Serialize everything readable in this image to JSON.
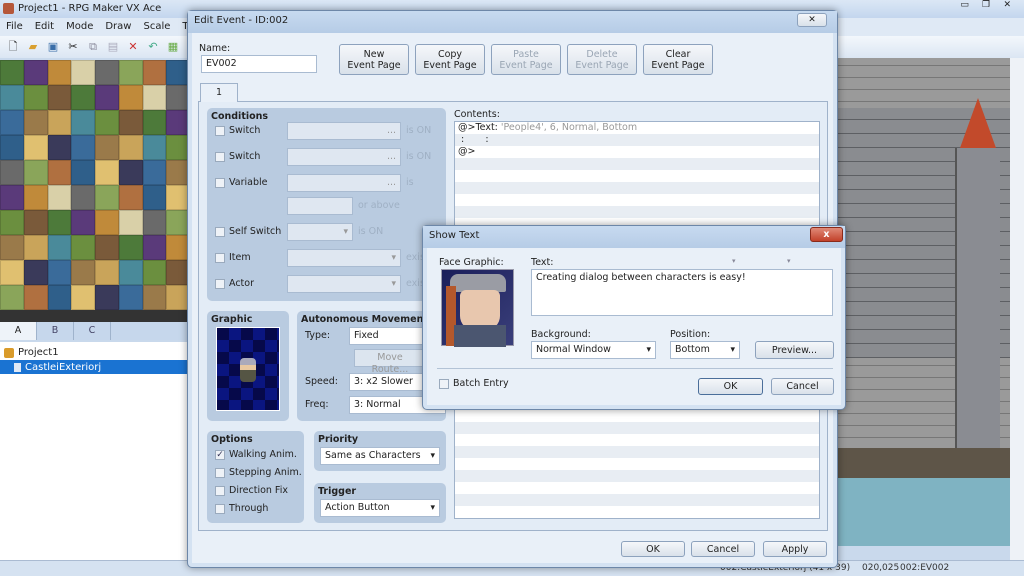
{
  "app": {
    "title": "Project1 - RPG Maker VX Ace",
    "menu": [
      "File",
      "Edit",
      "Mode",
      "Draw",
      "Scale",
      "Tools"
    ],
    "toolbar_icons": [
      "new-icon",
      "open-icon",
      "save-icon",
      "cut-icon",
      "copy-icon",
      "paste-icon",
      "delete-icon",
      "undo-icon",
      "tileset-icon"
    ],
    "tabs": [
      "A",
      "B",
      "C"
    ],
    "tree": {
      "project": "Project1",
      "map": "CastleiExteriorj"
    },
    "status": {
      "map": "002:CastleExteriorj (41 x 39)",
      "coords": "020,025",
      "event": "002:EV002"
    }
  },
  "edit_event": {
    "title": "Edit Event - ID:002",
    "name_label": "Name:",
    "name_value": "EV002",
    "buttons": {
      "new_page": "New\nEvent Page",
      "copy_page": "Copy\nEvent Page",
      "paste_page": "Paste\nEvent Page",
      "delete_page": "Delete\nEvent Page",
      "clear_page": "Clear\nEvent Page",
      "ok": "OK",
      "cancel": "Cancel",
      "apply": "Apply"
    },
    "page_tab": "1",
    "conditions": {
      "title": "Conditions",
      "switch1": "Switch",
      "switch2": "Switch",
      "variable": "Variable",
      "self_switch": "Self Switch",
      "item": "Item",
      "actor": "Actor",
      "is_on": "is ON",
      "is": "is",
      "or_above": "or above",
      "exists": "exists",
      "ellipsis": "..."
    },
    "graphic_title": "Graphic",
    "movement": {
      "title": "Autonomous Movement",
      "type_label": "Type:",
      "type": "Fixed",
      "move_route": "Move Route...",
      "speed_label": "Speed:",
      "speed": "3: x2 Slower",
      "freq_label": "Freq:",
      "freq": "3: Normal"
    },
    "options": {
      "title": "Options",
      "walking": "Walking Anim.",
      "stepping": "Stepping Anim.",
      "direction_fix": "Direction Fix",
      "through": "Through",
      "walking_checked": true
    },
    "priority": {
      "title": "Priority",
      "value": "Same as Characters"
    },
    "trigger": {
      "title": "Trigger",
      "value": "Action Button"
    },
    "contents": {
      "label": "Contents:",
      "line1_cmd": "@>Text:",
      "line1_args": "'People4', 6, Normal, Bottom",
      "line2": " :       :",
      "line3": "@>"
    }
  },
  "show_text": {
    "title": "Show Text",
    "close": "x",
    "face_label": "Face Graphic:",
    "text_label": "Text:",
    "text_value": "Creating dialog between characters is easy!",
    "background_label": "Background:",
    "background": "Normal Window",
    "position_label": "Position:",
    "position": "Bottom",
    "preview": "Preview...",
    "batch_entry": "Batch Entry",
    "ok": "OK",
    "cancel": "Cancel"
  }
}
